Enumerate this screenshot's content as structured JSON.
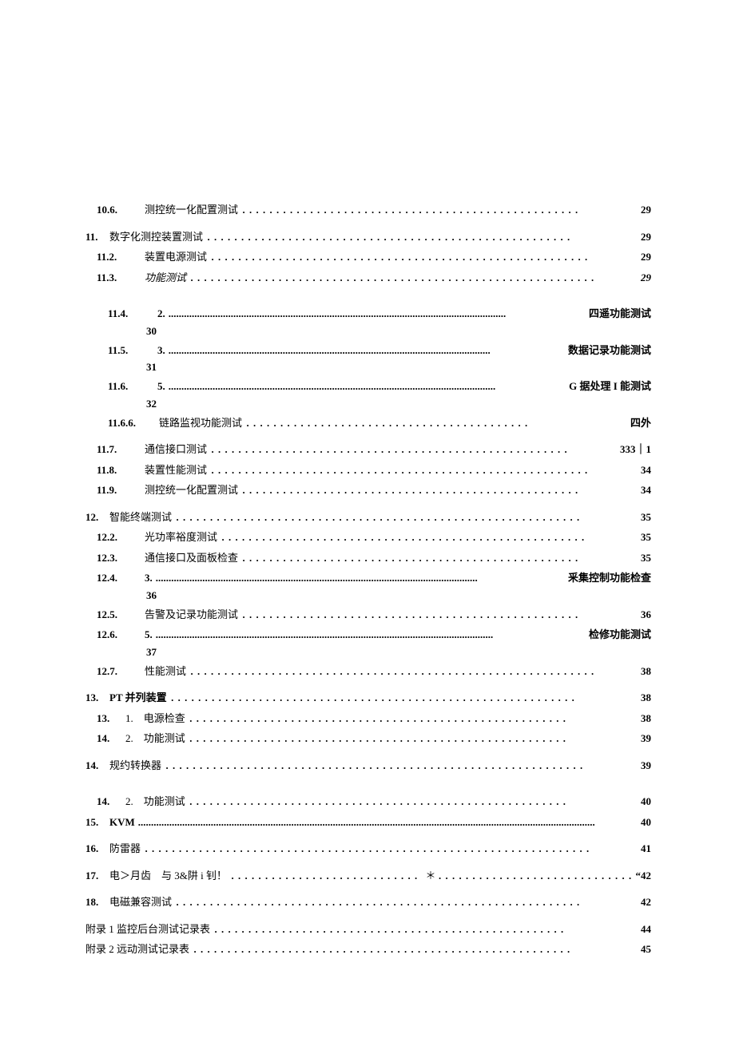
{
  "entries": [
    {
      "cls": "indent-1",
      "numCls": "w-num-a bold",
      "num": "10.6.",
      "titleCls": "",
      "title": "测控统一化配置测试",
      "leader": "．．．．．．．．．．．．．．．．．．．．．．．．．．．．．．．．．．．．．．．．．．．．．．．．．．",
      "pageCls": "bold",
      "page": "29",
      "gap": ""
    },
    {
      "cls": "",
      "numCls": "w-num-e bold",
      "num": "11.",
      "titleCls": "",
      "title": "数字化测控装置测试",
      "leader": "．．．．．．．．．．．．．．．．．．．．．．．．．．．．．．．．．．．．．．．．．．．．．．．．．．．．．．",
      "pageCls": "bold",
      "page": "29",
      "gap": "group-gap"
    },
    {
      "cls": "indent-1",
      "numCls": "w-num-a bold",
      "num": "11.2.",
      "titleCls": "",
      "title": "装置电源测试",
      "leader": "．．．．．．．．．．．．．．．．．．．．．．．．．．．．．．．．．．．．．．．．．．．．．．．．．．．．．．．．",
      "pageCls": "bold",
      "page": "29",
      "gap": "group-gap-s"
    },
    {
      "cls": "indent-1",
      "numCls": "w-num-a bold",
      "num": "11.3.",
      "titleCls": "italic",
      "title": "功能测试",
      "leader": "．．．．．．．．．．．．．．．．．．．．．．．．．．．．．．．．．．．．．．．．．．．．．．．．．．．．．．．．．．．．",
      "pageCls": "italic bold",
      "page": "29",
      "gap": ""
    },
    {
      "cls": "indent-2",
      "numCls": "w-num-b bold",
      "num": "11.4.",
      "titleCls": "bold",
      "title": "2.",
      "leader": "bold-leader:..................................................................................................................................",
      "pageCls": "bold",
      "page": "四遥功能测试",
      "gap": "group-gap-l",
      "sub": "30"
    },
    {
      "cls": "indent-2",
      "numCls": "w-num-b bold",
      "num": "11.5.",
      "titleCls": "bold",
      "title": "3.",
      "leader": "bold-leader:............................................................................................................................",
      "pageCls": "bold",
      "page": "数据记录功能测试",
      "gap": "",
      "sub": "31"
    },
    {
      "cls": "indent-2",
      "numCls": "w-num-b bold",
      "num": "11.6.",
      "titleCls": "bold",
      "title": "5.",
      "leader": "bold-leader:..............................................................................................................................",
      "pageCls": "bold",
      "page": "G 据处理 I 能测试",
      "gap": "",
      "sub": "32"
    },
    {
      "cls": "indent-2",
      "numCls": "w-num-c bold",
      "num": "11.6.6.",
      "titleCls": "",
      "title": "链路监视功能测试",
      "leader": "．．．．．．．．．．．．．．．．．．．．．．．．．．．．．．．．．．．．．．．．．．",
      "pageCls": "",
      "page": "四外",
      "gap": ""
    },
    {
      "cls": "indent-1",
      "numCls": "w-num-a bold",
      "num": "11.7.",
      "titleCls": "",
      "title": "通信接口测试",
      "leader": "．．．．．．．．．．．．．．．．．．．．．．．．．．．．．．．．．．．．．．．．．．．．．．．．．．．．．",
      "pageCls": "bold",
      "page": "333｜1",
      "gap": "group-gap"
    },
    {
      "cls": "indent-1",
      "numCls": "w-num-a bold",
      "num": "11.8.",
      "titleCls": "",
      "title": "装置性能测试",
      "leader": "．．．．．．．．．．．．．．．．．．．．．．．．．．．．．．．．．．．．．．．．．．．．．．．．．．．．．．．．",
      "pageCls": "bold",
      "page": "34",
      "gap": ""
    },
    {
      "cls": "indent-1",
      "numCls": "w-num-a bold",
      "num": "11.9.",
      "titleCls": "",
      "title": "测控统一化配置测试",
      "leader": "．．．．．．．．．．．．．．．．．．．．．．．．．．．．．．．．．．．．．．．．．．．．．．．．．．",
      "pageCls": "bold",
      "page": "34",
      "gap": ""
    },
    {
      "cls": "",
      "numCls": "w-num-e bold",
      "num": "12.",
      "titleCls": "",
      "title": "智能终端测试",
      "leader": "．．．．．．．．．．．．．．．．．．．．．．．．．．．．．．．．．．．．．．．．．．．．．．．．．．．．．．．．．．．．",
      "pageCls": "bold",
      "page": "35",
      "gap": "group-gap"
    },
    {
      "cls": "indent-1",
      "numCls": "w-num-a bold",
      "num": "12.2.",
      "titleCls": "",
      "title": "光功率裕度测试",
      "leader": "．．．．．．．．．．．．．．．．．．．．．．．．．．．．．．．．．．．．．．．．．．．．．．．．．．．．．．",
      "pageCls": "bold",
      "page": "35",
      "gap": "group-gap-s"
    },
    {
      "cls": "indent-1",
      "numCls": "w-num-a bold",
      "num": "12.3.",
      "titleCls": "",
      "title": "通信接口及面板检查",
      "leader": "．．．．．．．．．．．．．．．．．．．．．．．．．．．．．．．．．．．．．．．．．．．．．．．．．．",
      "pageCls": "bold",
      "page": "35",
      "gap": ""
    },
    {
      "cls": "indent-1",
      "numCls": "w-num-a bold",
      "num": "12.4.",
      "titleCls": "bold",
      "title": "3.",
      "leader": "bold-leader:............................................................................................................................",
      "pageCls": "bold",
      "page": "釆集控制功能检查",
      "gap": "",
      "sub": "36"
    },
    {
      "cls": "indent-1",
      "numCls": "w-num-a bold",
      "num": "12.5.",
      "titleCls": "",
      "title": "告警及记录功能测试",
      "leader": "．．．．．．．．．．．．．．．．．．．．．．．．．．．．．．．．．．．．．．．．．．．．．．．．．．",
      "pageCls": "bold",
      "page": "36",
      "gap": ""
    },
    {
      "cls": "indent-1",
      "numCls": "w-num-a bold",
      "num": "12.6.",
      "titleCls": "bold",
      "title": "5.",
      "leader": "bold-leader:..................................................................................................................................",
      "pageCls": "bold",
      "page": "检修功能测试",
      "gap": "",
      "sub": "37"
    },
    {
      "cls": "indent-1",
      "numCls": "w-num-a bold",
      "num": "12.7.",
      "titleCls": "",
      "title": "性能测试",
      "leader": "．．．．．．．．．．．．．．．．．．．．．．．．．．．．．．．．．．．．．．．．．．．．．．．．．．．．．．．．．．．．",
      "pageCls": "bold",
      "page": "38",
      "gap": "group-gap-s"
    },
    {
      "cls": "",
      "numCls": "w-num-e bold",
      "num": "13.",
      "titleCls": "bold",
      "title": "PT 并列装置",
      "leader": "．．．．．．．．．．．．．．．．．．．．．．．．．．．．．．．．．．．．．．．．．．．．．．．．．．．．．．．．．．．．",
      "pageCls": "bold",
      "page": "38",
      "gap": "group-gap"
    },
    {
      "cls": "indent-1",
      "numCls": "w-num-f bold",
      "num": "13.",
      "titleCls": "",
      "title": "1.　电源检查",
      "leader": "．．．．．．．．．．．．．．．．．．．．．．．．．．．．．．．．．．．．．．．．．．．．．．．．．．．．．．．．",
      "pageCls": "bold",
      "page": "38",
      "gap": "group-gap-s"
    },
    {
      "cls": "indent-1",
      "numCls": "w-num-f bold",
      "num": "14.",
      "titleCls": "",
      "title": "2.　功能测试",
      "leader": "．．．．．．．．．．．．．．．．．．．．．．．．．．．．．．．．．．．．．．．．．．．．．．．．．．．．．．．．",
      "pageCls": "bold",
      "page": "39",
      "gap": ""
    },
    {
      "cls": "",
      "numCls": "w-num-e bold",
      "num": "14.",
      "titleCls": "",
      "title": "规约转换器",
      "leader": "．．．．．．．．．．．．．．．．．．．．．．．．．．．．．．．．．．．．．．．．．．．．．．．．．．．．．．．．．．．．．．",
      "pageCls": "bold",
      "page": "39",
      "gap": "group-gap"
    },
    {
      "cls": "indent-1",
      "numCls": "w-num-f bold",
      "num": "14.",
      "titleCls": "",
      "title": "2.　功能测试",
      "leader": "．．．．．．．．．．．．．．．．．．．．．．．．．．．．．．．．．．．．．．．．．．．．．．．．．．．．．．．．",
      "pageCls": "bold",
      "page": "40",
      "gap": "group-gap-l"
    },
    {
      "cls": "",
      "numCls": "w-num-e bold",
      "num": "15.",
      "titleCls": "bold",
      "title": "KVM",
      "leader": "bold-leader:................................................................................................................................................................................",
      "pageCls": "bold",
      "page": "40",
      "gap": "group-gap-s"
    },
    {
      "cls": "",
      "numCls": "w-num-e bold",
      "num": "16.",
      "titleCls": "",
      "title": "防雷器",
      "leader": "．．．．．．．．．．．．．．．．．．．．．．．．．．．．．．．．．．．．．．．．．．．．．．．．．．．．．．．．．．．．．．．．．．",
      "pageCls": "bold",
      "page": "41",
      "gap": "group-gap"
    },
    {
      "cls": "",
      "numCls": "w-num-e bold",
      "num": "17.",
      "titleCls": "",
      "title": "电＞月齿　与 3&阱 i 钊！",
      "leader": "．．．．．．．．．．．．．．．．．．．．．．．．．．．．＊．．．．．．．．．．．．．．．．．．．．．．．．．．．．．",
      "pageCls": "bold",
      "page": "“42",
      "gap": "group-gap"
    },
    {
      "cls": "",
      "numCls": "w-num-e bold",
      "num": "18.",
      "titleCls": "",
      "title": "电磁兼容测试",
      "leader": "．．．．．．．．．．．．．．．．．．．．．．．．．．．．．．．．．．．．．．．．．．．．．．．．．．．．．．．．．．．．",
      "pageCls": "bold",
      "page": "42",
      "gap": "group-gap"
    },
    {
      "cls": "",
      "numCls": "",
      "num": "",
      "titleCls": "",
      "title": "附录 1 监控后台测试记录表",
      "leader": "．．．．．．．．．．．．．．．．．．．．．．．．．．．．．．．．．．．．．．．．．．．．．．．．．．．．",
      "pageCls": "bold",
      "page": "44",
      "gap": "group-gap"
    },
    {
      "cls": "",
      "numCls": "",
      "num": "",
      "titleCls": "",
      "title": "附录 2 远动测试记录表",
      "leader": "．．．．．．．．．．．．．．．．．．．．．．．．．．．．．．．．．．．．．．．．．．．．．．．．．．．．．．．．",
      "pageCls": "bold",
      "page": "45",
      "gap": "group-gap-s"
    }
  ]
}
